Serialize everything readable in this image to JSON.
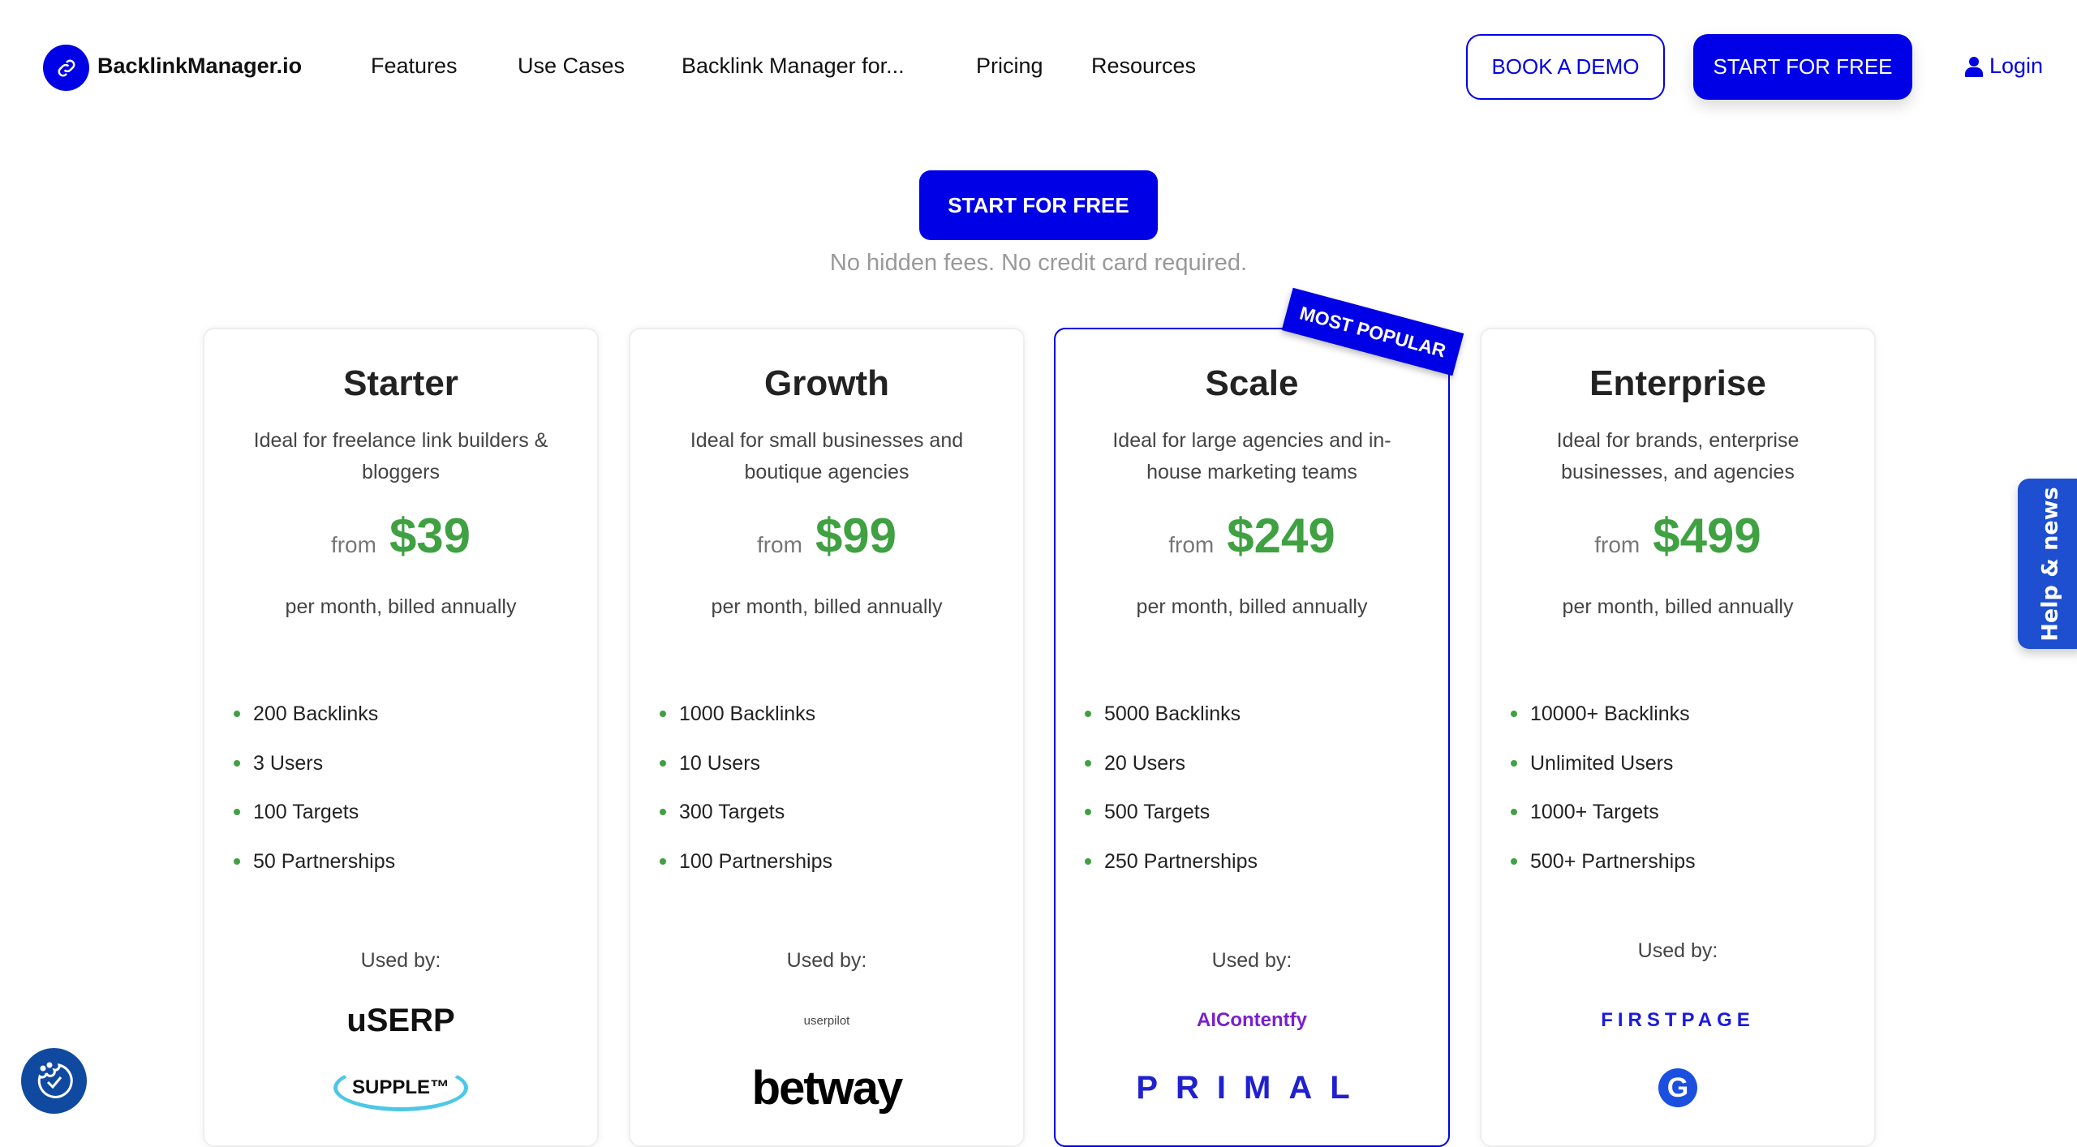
{
  "nav": {
    "brand": "BacklinkManager.io",
    "items": [
      "Features",
      "Use Cases",
      "Backlink Manager for...",
      "Pricing",
      "Resources"
    ],
    "book_demo": "BOOK A DEMO",
    "start_free": "START FOR FREE",
    "login": "Login"
  },
  "hero": {
    "cta": "START FOR FREE",
    "subtext": "No hidden fees. No credit card required."
  },
  "badge": "MOST POPULAR",
  "plans": [
    {
      "name": "Starter",
      "desc": "Ideal for freelance link builders & bloggers",
      "from": "from",
      "price": "$39",
      "period": "per month, billed annually",
      "features": [
        "200 Backlinks",
        "3 Users",
        "100 Targets",
        "50 Partnerships"
      ],
      "used_by": "Used by:",
      "logos": [
        "uSERP",
        "SUPPLE™"
      ]
    },
    {
      "name": "Growth",
      "desc": "Ideal for small businesses and boutique agencies",
      "from": "from",
      "price": "$99",
      "period": "per month, billed annually",
      "features": [
        "1000 Backlinks",
        "10 Users",
        "300 Targets",
        "100 Partnerships"
      ],
      "used_by": "Used by:",
      "logos": [
        "userpilot",
        "betway"
      ]
    },
    {
      "name": "Scale",
      "desc": "Ideal for large agencies and in-house marketing teams",
      "from": "from",
      "price": "$249",
      "period": "per month, billed annually",
      "features": [
        "5000 Backlinks",
        "20 Users",
        "500 Targets",
        "250 Partnerships"
      ],
      "used_by": "Used by:",
      "logos": [
        "AIContentfy",
        "PRIMAL"
      ]
    },
    {
      "name": "Enterprise",
      "desc": "Ideal for brands, enterprise businesses, and agencies",
      "from": "from",
      "price": "$499",
      "period": "per month, billed annually",
      "features": [
        "10000+ Backlinks",
        "Unlimited Users",
        "1000+ Targets",
        "500+ Partnerships"
      ],
      "used_by": "Used by:",
      "logos": [
        "FIRSTPAGE",
        "G"
      ]
    }
  ],
  "help_tab": "Help & news",
  "colors": {
    "primary": "#0000e6",
    "price": "#3fa142",
    "help": "#1d4fd0",
    "cookie": "#0f4aa0"
  }
}
